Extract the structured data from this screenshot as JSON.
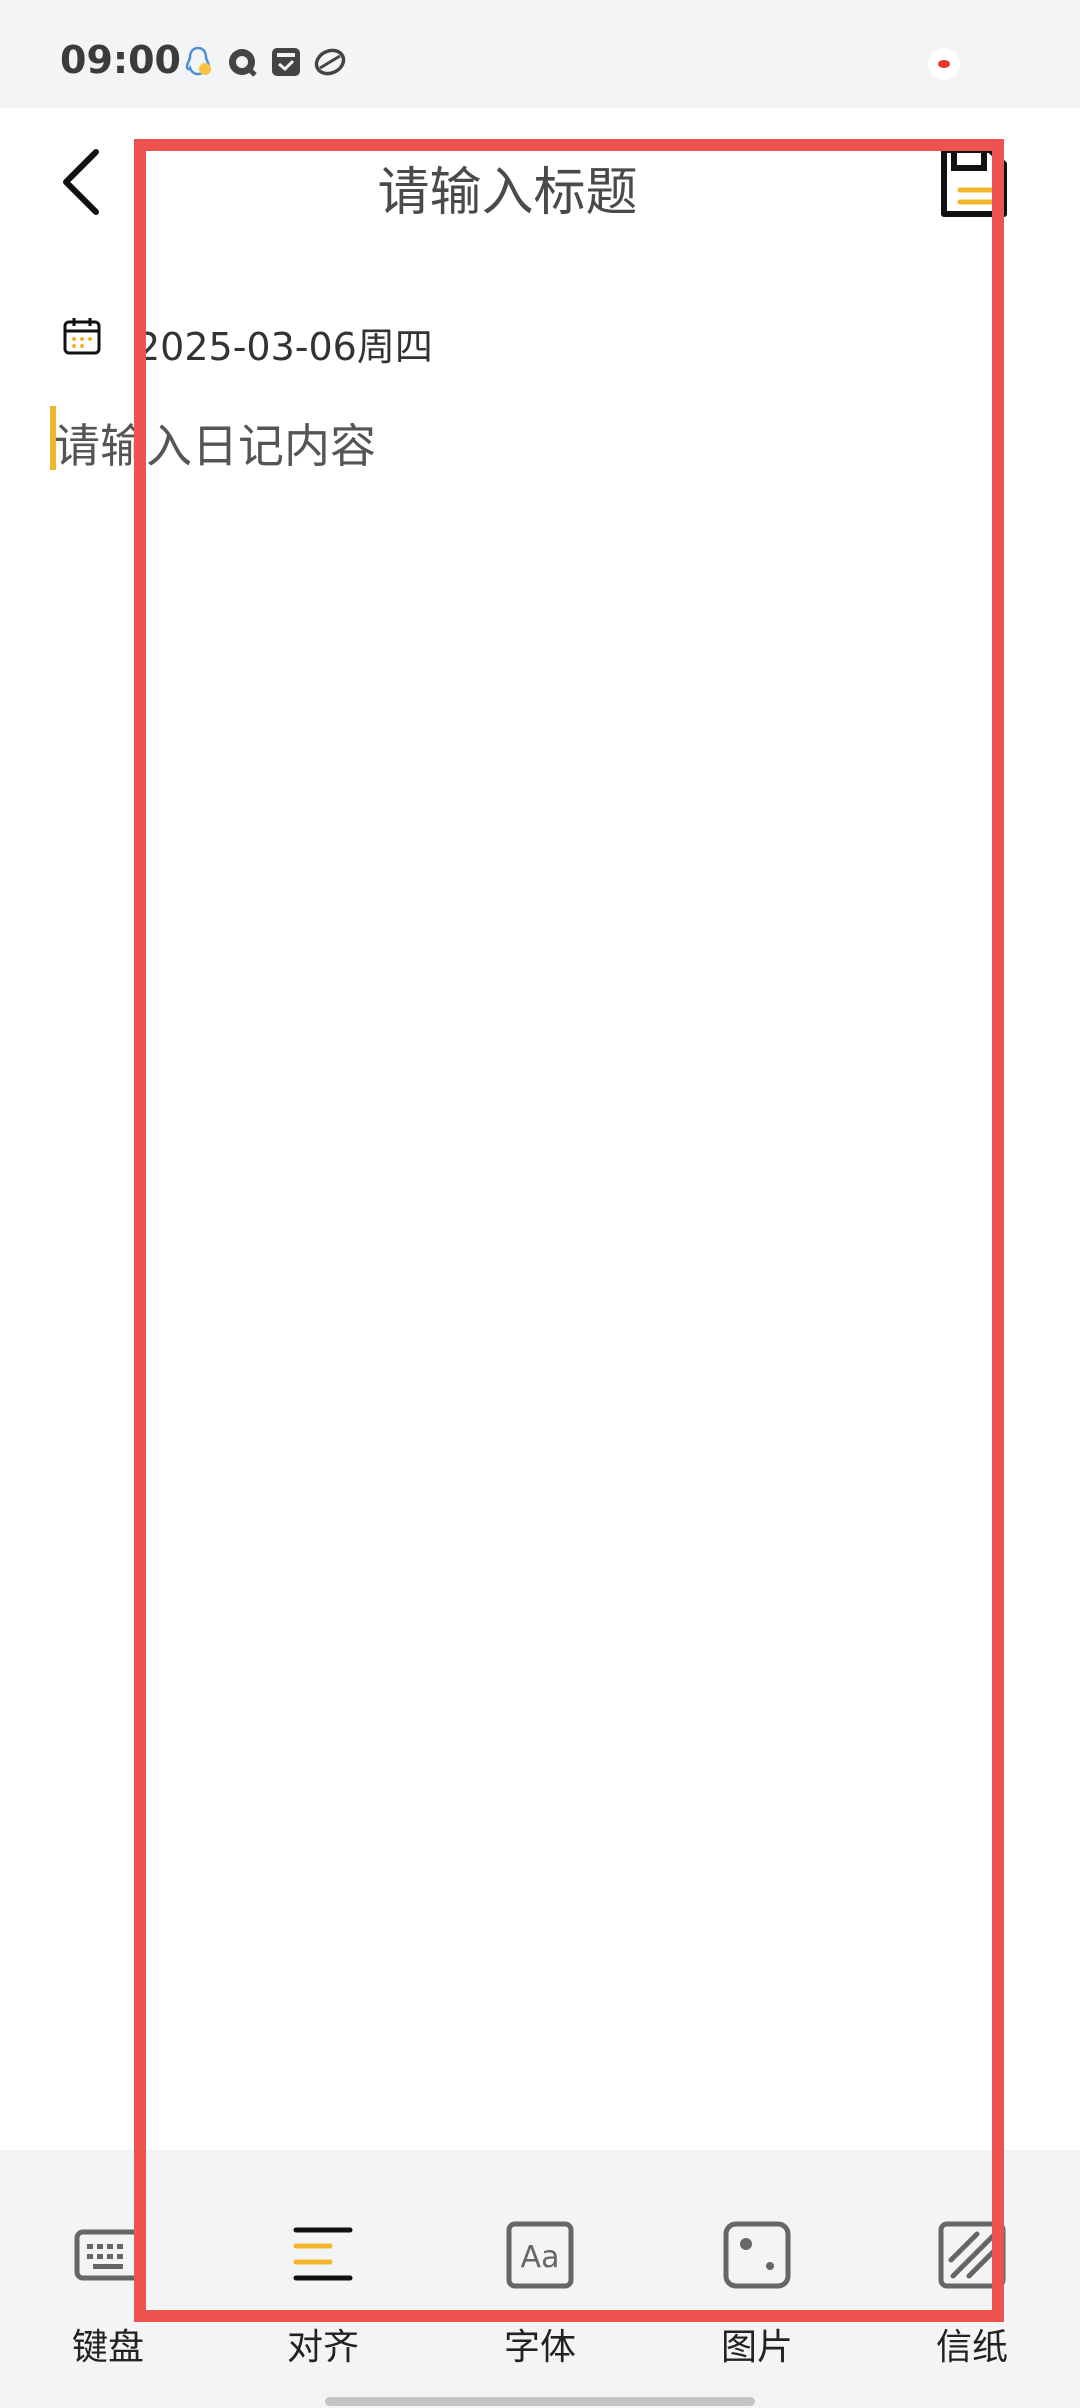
{
  "status_bar": {
    "time": "09:00",
    "icons": [
      "qq-penguin-icon",
      "chat-bubble-icon",
      "archive-box-icon",
      "ball-icon"
    ]
  },
  "header": {
    "title": "请输入标题",
    "back_icon": "back-arrow-icon",
    "save_icon": "save-disk-icon"
  },
  "entry": {
    "date": "2025-03-06周四",
    "content_placeholder": "请输入日记内容"
  },
  "toolbar": {
    "items": [
      {
        "label": "键盘",
        "icon": "keyboard-icon"
      },
      {
        "label": "对齐",
        "icon": "align-icon"
      },
      {
        "label": "字体",
        "icon": "font-icon"
      },
      {
        "label": "图片",
        "icon": "image-icon"
      },
      {
        "label": "信纸",
        "icon": "stationery-icon"
      }
    ]
  },
  "colors": {
    "accent": "#f3b52c",
    "annotation": "#ef5350",
    "toolbar_bg": "#f3f4f6"
  }
}
